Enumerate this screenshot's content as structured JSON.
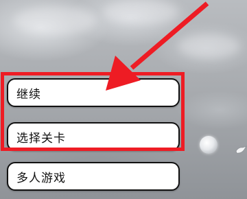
{
  "menu": {
    "continue_label": "继续",
    "select_level_label": "选择关卡",
    "multiplayer_label": "多人游戏"
  },
  "colors": {
    "annotation_red": "#ee1c24",
    "button_fill": "#ffffff",
    "button_border": "#111111"
  },
  "icons": {
    "arrow": "annotation-arrow-icon",
    "orb": "orb-icon",
    "shard": "shard-icon"
  }
}
